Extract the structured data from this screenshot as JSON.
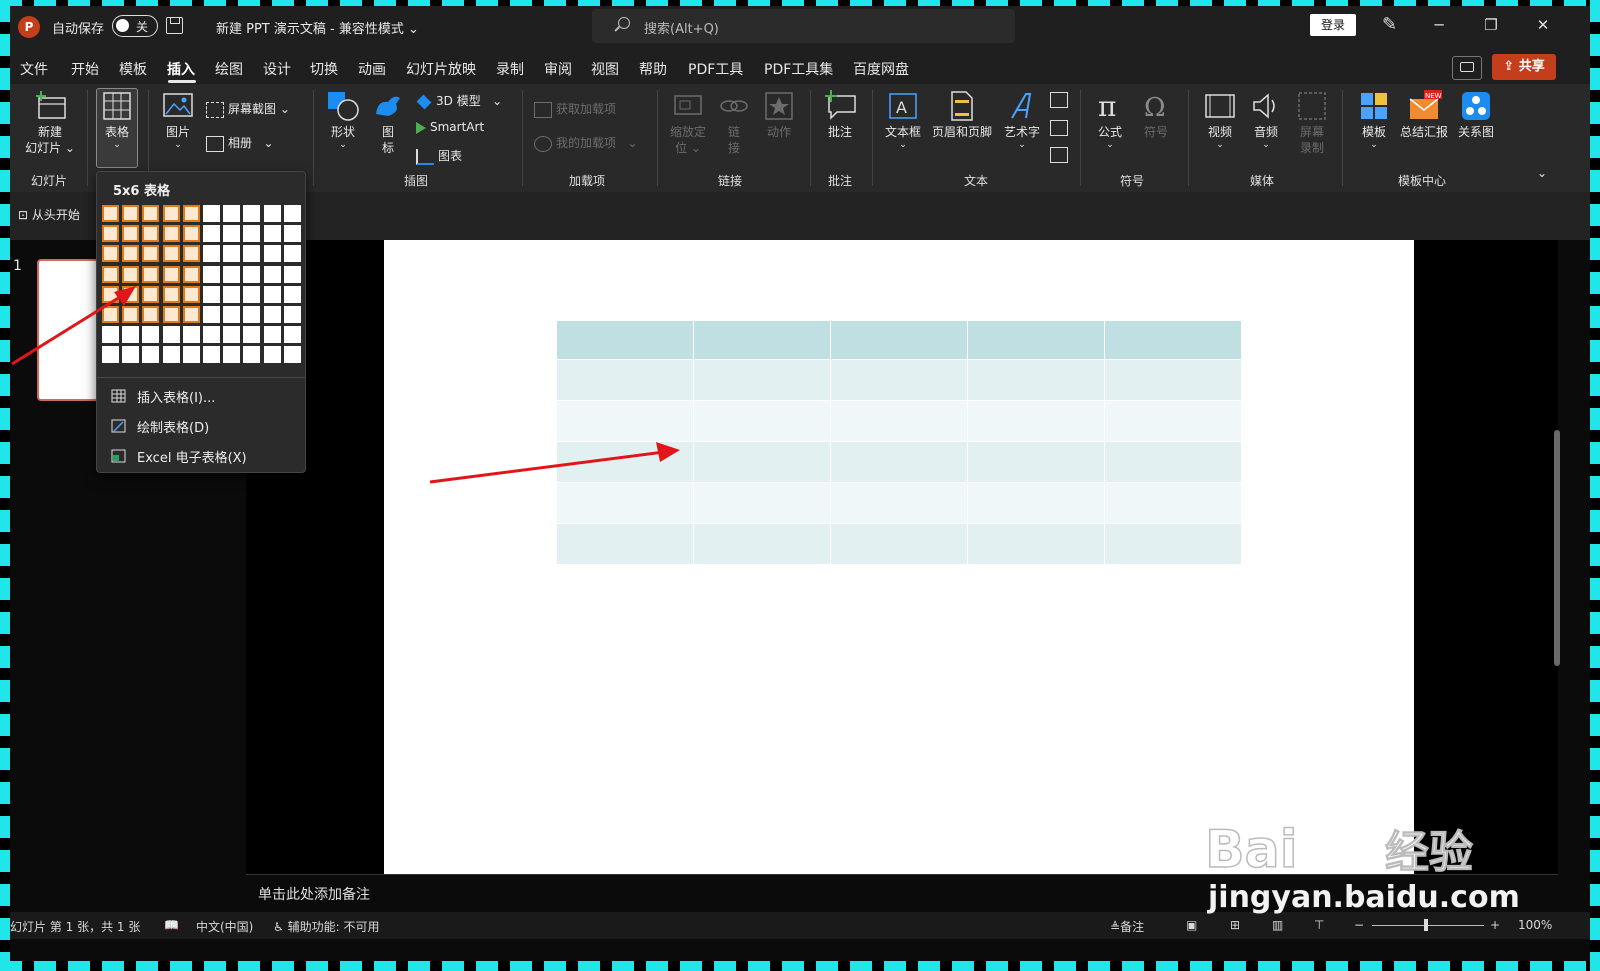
{
  "title_bar": {
    "app_badge": "P",
    "autosave_label": "自动保存",
    "autosave_state": "关",
    "doc_title": "新建 PPT 演示文稿  -  兼容性模式 ⌄",
    "search_placeholder": "搜索(Alt+Q)",
    "login_label": "登录",
    "min": "─",
    "restore": "❐",
    "close": "✕"
  },
  "menu": {
    "items": [
      "文件",
      "开始",
      "模板",
      "插入",
      "绘图",
      "设计",
      "切换",
      "动画",
      "幻灯片放映",
      "录制",
      "审阅",
      "视图",
      "帮助",
      "PDF工具",
      "PDF工具集",
      "百度网盘"
    ],
    "active": "插入",
    "share_label": "共享"
  },
  "ribbon": {
    "new_slide": "新建",
    "new_slide_2": "幻灯片 ⌄",
    "group_slides": "幻灯片",
    "table": "表格",
    "picture": "图片",
    "screenshot": "屏幕截图",
    "album": "相册",
    "shapes": "形状",
    "icons": "图",
    "icons_2": "标",
    "model3d": "3D 模型",
    "smartart": "SmartArt",
    "chart": "图表",
    "group_illustrations": "插图",
    "get_addins": "获取加载项",
    "my_addins": "我的加载项",
    "group_addins": "加载项",
    "zoom": "缩放定",
    "zoom_2": "位 ⌄",
    "link": "链",
    "link_2": "接",
    "action": "动作",
    "group_links": "链接",
    "comment": "批注",
    "group_comments": "批注",
    "textbox": "文本框",
    "header_footer": "页眉和页脚",
    "wordart": "艺术字",
    "group_text": "文本",
    "equation": "公式",
    "symbol": "符号",
    "group_symbols": "符号",
    "video": "视频",
    "audio": "音频",
    "screen_rec": "屏幕",
    "screen_rec_2": "录制",
    "group_media": "媒体",
    "template": "模板",
    "summary": "总结汇报",
    "new_badge": "NEW",
    "relation": "关系图",
    "group_template_center": "模板中心"
  },
  "quick_access": {
    "from_start": "从头开始"
  },
  "slides_panel": {
    "slide_number": "1"
  },
  "table_dropdown": {
    "title": "5x6 表格",
    "grid_cols": 10,
    "grid_rows": 8,
    "selected_cols": 5,
    "selected_rows": 6,
    "items": [
      "插入表格(I)...",
      "绘制表格(D)",
      "Excel 电子表格(X)"
    ]
  },
  "slide_table": {
    "rows": 6,
    "cols": 5
  },
  "notes": {
    "placeholder": "单击此处添加备注"
  },
  "status_bar": {
    "slide_info": "幻灯片 第 1 张，共 1 张",
    "language": "中文(中国)",
    "accessibility": "辅助功能: 不可用",
    "notes_label": "备注",
    "zoom_value": "100%",
    "minus": "−",
    "plus": "+"
  },
  "watermark": {
    "brand": "Bai du 经验",
    "url": "jingyan.baidu.com"
  },
  "colors": {
    "accent_orange": "#e07b1a",
    "share_red": "#c43e1c",
    "table_header": "#bfdfe2",
    "arrow_red": "#e0161a"
  }
}
